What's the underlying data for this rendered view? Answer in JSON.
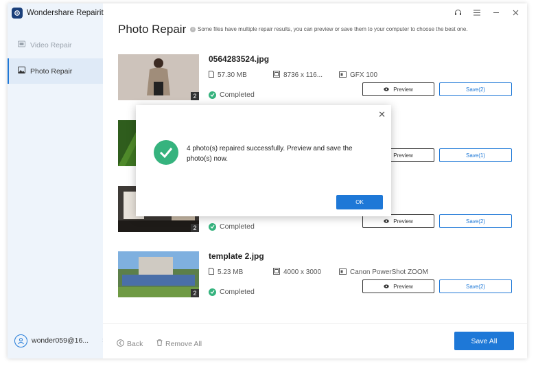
{
  "app": {
    "title": "Wondershare Repairit"
  },
  "sidebar": {
    "items": [
      {
        "label": "Video Repair",
        "icon": "video-icon"
      },
      {
        "label": "Photo Repair",
        "icon": "image-icon"
      }
    ],
    "user": {
      "label": "wonder059@16..."
    }
  },
  "main": {
    "title": "Photo Repair",
    "hint": "Some files have multiple repair results, you can preview or save them to your computer to choose the best one."
  },
  "files": [
    {
      "name": "0564283524.jpg",
      "size": "57.30  MB",
      "resolution": "8736 x 116...",
      "camera": "GFX 100",
      "status": "Completed",
      "badge": "2",
      "preview_label": "Preview",
      "save_label": "Save(2)"
    },
    {
      "name": "",
      "size": "",
      "resolution": "",
      "camera": "",
      "status": "",
      "badge": "",
      "preview_label": "Preview",
      "save_label": "Save(1)"
    },
    {
      "name": "",
      "size": "",
      "resolution": "",
      "camera": "",
      "status": "Completed",
      "badge": "2",
      "preview_label": "Preview",
      "save_label": "Save(2)"
    },
    {
      "name": "template 2.jpg",
      "size": "5.23  MB",
      "resolution": "4000 x 3000",
      "camera": "Canon PowerShot ZOOM",
      "status": "Completed",
      "badge": "2",
      "preview_label": "Preview",
      "save_label": "Save(2)"
    }
  ],
  "bottombar": {
    "back_label": "Back",
    "remove_label": "Remove All",
    "save_all_label": "Save All"
  },
  "dialog": {
    "message": "4 photo(s) repaired successfully. Preview and save the photo(s) now.",
    "ok_label": "OK"
  },
  "colors": {
    "accent": "#1e78d7",
    "success": "#36b37e",
    "sidebar_bg": "#eef4fb"
  }
}
